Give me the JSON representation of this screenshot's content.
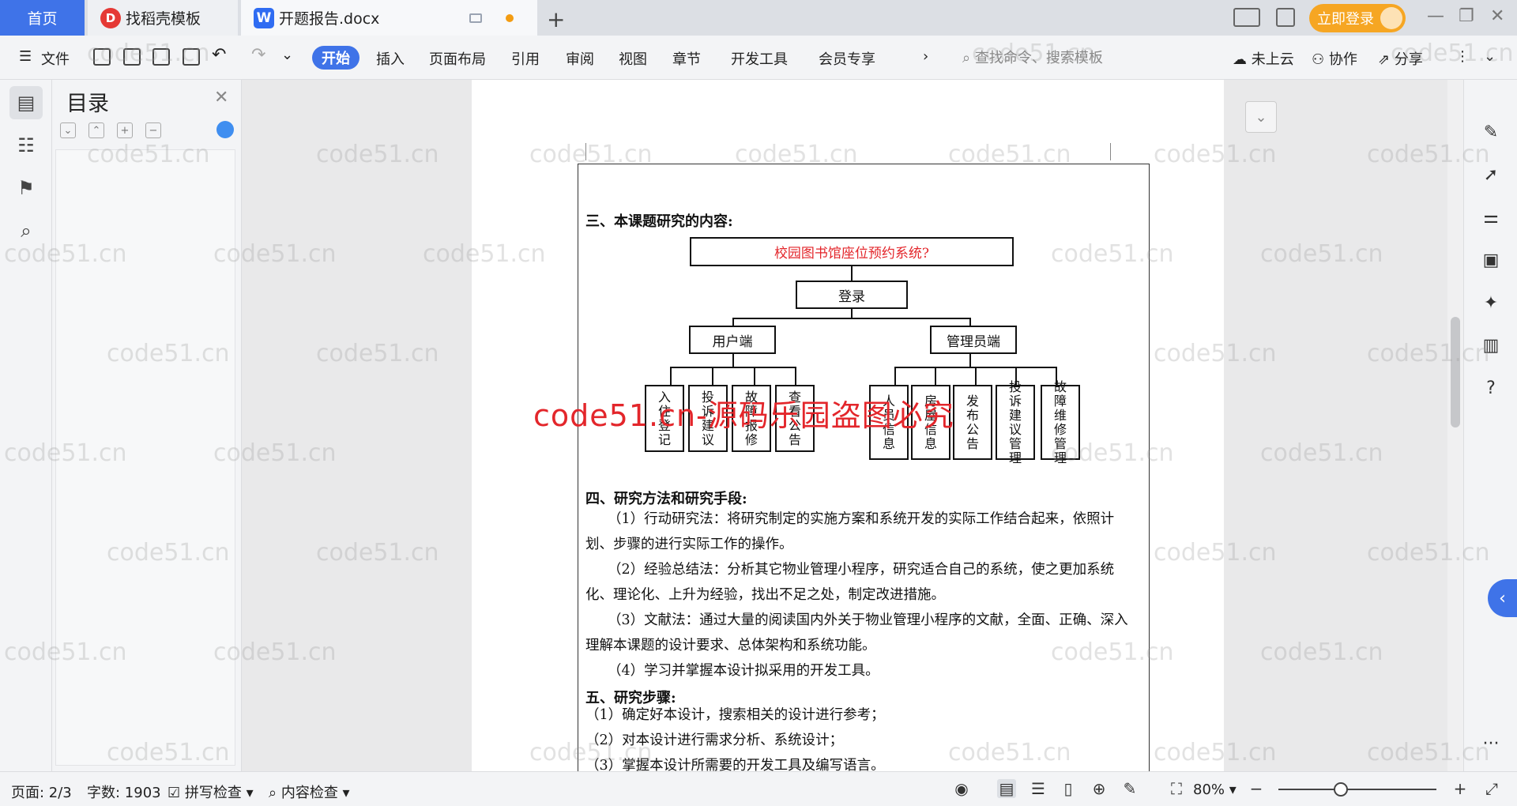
{
  "tabs": {
    "home": "首页",
    "template": "找稻壳模板",
    "document": "开题报告.docx",
    "template_badge": "D",
    "doc_badge": "W"
  },
  "account": {
    "login_label": "立即登录"
  },
  "menu": {
    "file": "文件",
    "items": [
      "开始",
      "插入",
      "页面布局",
      "引用",
      "审阅",
      "视图",
      "章节",
      "开发工具",
      "会员专享"
    ],
    "search_placeholder": "查找命令、搜索模板",
    "cloud": "未上云",
    "collab": "协作",
    "share": "分享"
  },
  "toc": {
    "title": "目录"
  },
  "document": {
    "section3_heading": "三、本课题研究的内容:",
    "diagram": {
      "root": "校园图书馆座位预约系统?",
      "login": "登录",
      "user_side": "用户端",
      "admin_side": "管理员端",
      "user_leaves": [
        "入住登记",
        "投诉建议",
        "故障报修",
        "查看公告"
      ],
      "admin_leaves": [
        "人员信息",
        "房屋信息",
        "发布公告",
        "投诉建议管理",
        "故障维修管理"
      ]
    },
    "section4_heading": "四、研究方法和研究手段:",
    "section4_paras": [
      "（1）行动研究法：将研究制定的实施方案和系统开发的实际工作结合起来，依照计划、步骤的进行实际工作的操作。",
      "（2）经验总结法：分析其它物业管理小程序，研究适合自己的系统，使之更加系统化、理论化、上升为经验，找出不足之处，制定改进措施。",
      "（3）文献法：通过大量的阅读国内外关于物业管理小程序的文献，全面、正确、深入理解本课题的设计要求、总体架构和系统功能。",
      "（4）学习并掌握本设计拟采用的开发工具。"
    ],
    "section5_heading": "五、研究步骤:",
    "section5_paras": [
      "（1）确定好本设计，搜索相关的设计进行参考；",
      "（2）对本设计进行需求分析、系统设计；",
      "（3）掌握本设计所需要的开发工具及编写语言。"
    ]
  },
  "watermark": {
    "small": "code51.cn",
    "big": "code51.cn-源码乐园盗图必究"
  },
  "status": {
    "page": "页面: 2/3",
    "words": "字数: 1903",
    "spell": "拼写检查",
    "content": "内容检查",
    "zoom": "80%"
  }
}
